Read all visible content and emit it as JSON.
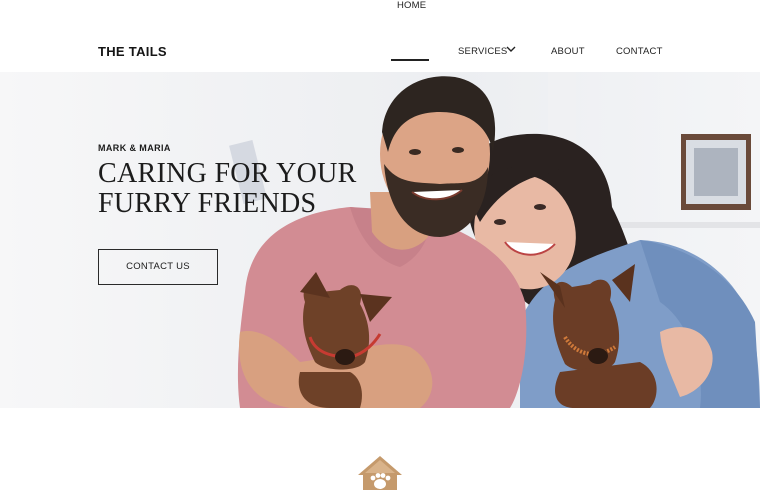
{
  "header": {
    "logo": "THE TAILS",
    "nav": {
      "home": "HOME",
      "services": "SERVICES",
      "about": "ABOUT",
      "contact": "CONTACT"
    }
  },
  "hero": {
    "eyebrow": "MARK & MARIA",
    "headline_line1": "CARING FOR YOUR",
    "headline_line2": "FURRY FRIENDS",
    "cta_label": "CONTACT US"
  },
  "icons": {
    "services_chevron": "chevron-down-icon",
    "section_icon": "paw-house-icon"
  },
  "colors": {
    "accent": "#c59a6c",
    "text": "#1b1b1b"
  }
}
